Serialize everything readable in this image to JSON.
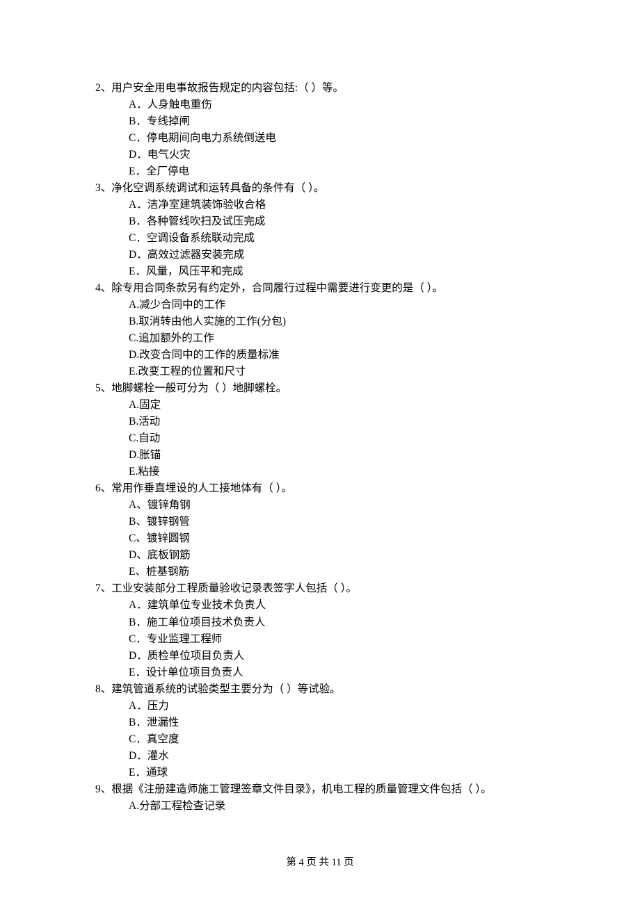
{
  "questions": [
    {
      "num": "2、",
      "text": "用户安全用电事故报告规定的内容包括:（    ）等。",
      "options": [
        "A．人身触电重伤",
        "B．专线掉闸",
        "C．停电期间向电力系统倒送电",
        "D．电气火灾",
        "E．全厂停电"
      ]
    },
    {
      "num": "3、",
      "text": "净化空调系统调试和运转具备的条件有（    ）。",
      "options": [
        "A．洁净室建筑装饰验收合格",
        "B．各种管线吹扫及试压完成",
        "C．空调设备系统联动完成",
        "D．高效过滤器安装完成",
        "E．风量，风压平和完成"
      ]
    },
    {
      "num": "4、",
      "text": "除专用合同条款另有约定外，合同履行过程中需要进行变更的是（    ）。",
      "options": [
        "A.减少合同中的工作",
        "B.取消转由他人实施的工作(分包)",
        "C.追加额外的工作",
        "D.改变合同中的工作的质量标准",
        "E.改变工程的位置和尺寸"
      ]
    },
    {
      "num": "5、",
      "text": "地脚螺栓一般可分为（    ）地脚螺栓。",
      "options": [
        "A.固定",
        "B.活动",
        "C.自动",
        "D.胀锚",
        "E.粘接"
      ]
    },
    {
      "num": "6、",
      "text": "常用作垂直埋设的人工接地体有（    ）。",
      "options": [
        "A、镀锌角钢",
        "B、镀锌钢管",
        "C、镀锌圆钢",
        "D、底板钢筋",
        "E、桩基钢筋"
      ]
    },
    {
      "num": "7、",
      "text": "工业安装部分工程质量验收记录表签字人包括（    ）。",
      "options": [
        "A．建筑单位专业技术负责人",
        "B．施工单位项目技术负责人",
        "C．专业监理工程师",
        "D．质检单位项目负责人",
        "E．设计单位项目负责人"
      ]
    },
    {
      "num": "8、",
      "text": "建筑管道系统的试验类型主要分为（    ）等试验。",
      "options": [
        "A．压力",
        "B．泄漏性",
        "C．真空度",
        "D．灌水",
        "E．通球"
      ]
    },
    {
      "num": "9、",
      "text": "根据《注册建造师施工管理签章文件目录》，机电工程的质量管理文件包括（    ）。",
      "options": [
        "A.分部工程检查记录"
      ]
    }
  ],
  "footer": "第 4 页 共 11 页"
}
